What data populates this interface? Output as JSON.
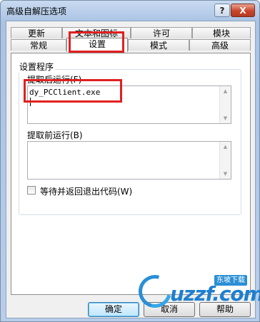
{
  "window": {
    "title": "高级自解压选项"
  },
  "titlebar": {
    "help_glyph": "?",
    "close_glyph": "X"
  },
  "tabs": {
    "back_row": [
      "更新",
      "文本和图标",
      "许可",
      "模块"
    ],
    "front_row": [
      "常规",
      "设置",
      "模式",
      "高级"
    ],
    "active": "设置"
  },
  "setup_group": {
    "title": "设置程序",
    "run_after_label": "提取后运行(F)",
    "run_after_value": "dy_PCClient.exe",
    "run_before_label": "提取前运行(B)",
    "run_before_value": ""
  },
  "wait_checkbox": {
    "label": "等待并返回退出代码(W)",
    "checked": false
  },
  "buttons": {
    "ok": "确定",
    "cancel": "取消",
    "help": "帮助"
  },
  "watermark": {
    "brand": "uzzf.com",
    "badge": "东坡下载"
  },
  "colors": {
    "highlight": "#e02020",
    "watermark": "#1e7fd0"
  }
}
